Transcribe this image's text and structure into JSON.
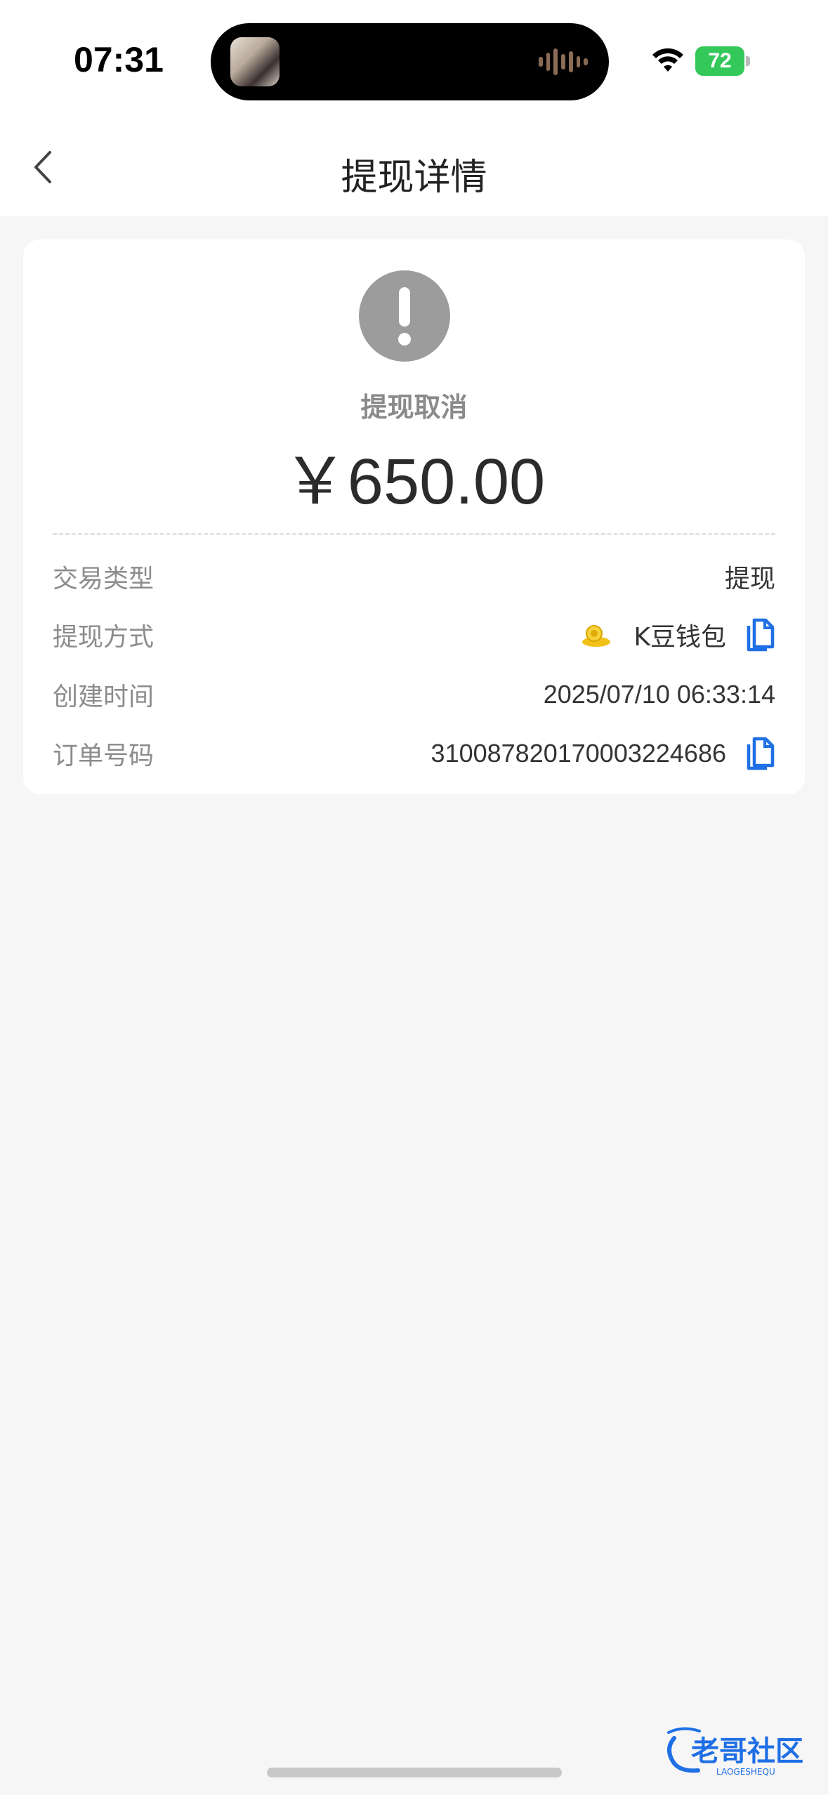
{
  "status_bar": {
    "time": "07:31",
    "battery_level": "72",
    "battery_color": "#34c759"
  },
  "nav": {
    "title": "提现详情",
    "back_icon": "chevron-left-icon"
  },
  "detail": {
    "status_icon": "exclamation-icon",
    "status_text": "提现取消",
    "amount": "￥650.00",
    "rows": [
      {
        "label": "交易类型",
        "value": "提现"
      },
      {
        "label": "提现方式",
        "value": "K豆钱包",
        "icon": "coin-icon"
      },
      {
        "label": "创建时间",
        "value": "2025/07/10 06:33:14"
      },
      {
        "label": "订单号码",
        "value": "310087820170003224686"
      }
    ]
  },
  "watermark": {
    "text": "老哥社区",
    "subtext": "LAOGESHEQU"
  },
  "colors": {
    "accent_blue": "#1f6fe5",
    "icon_gray": "#9c9c9c"
  }
}
